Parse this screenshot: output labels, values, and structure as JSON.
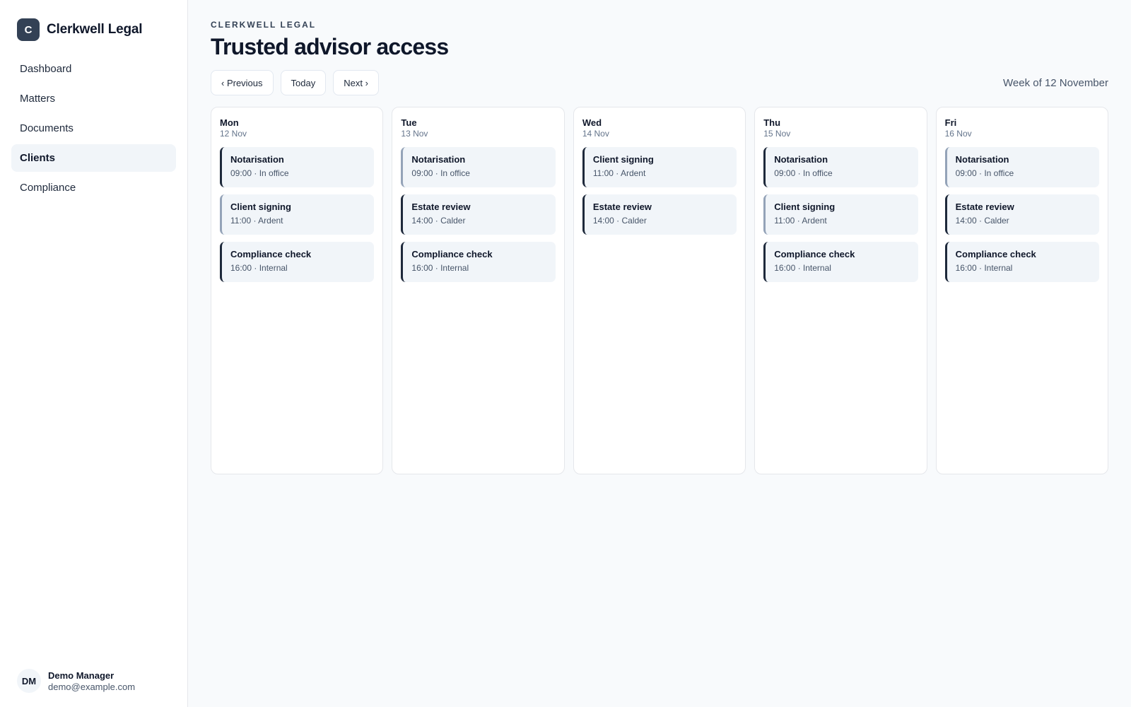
{
  "brand": {
    "logo_letter": "C",
    "name": "Clerkwell Legal"
  },
  "nav": [
    {
      "label": "Dashboard",
      "active": false
    },
    {
      "label": "Matters",
      "active": false
    },
    {
      "label": "Documents",
      "active": false
    },
    {
      "label": "Clients",
      "active": true
    },
    {
      "label": "Compliance",
      "active": false
    }
  ],
  "user": {
    "initials": "DM",
    "name": "Demo Manager",
    "email": "demo@example.com"
  },
  "header": {
    "eyebrow": "CLERKWELL LEGAL",
    "title": "Trusted advisor access"
  },
  "toolbar": {
    "previous_label": "‹ Previous",
    "today_label": "Today",
    "next_label": "Next ›",
    "week_label": "Week of 12 November"
  },
  "colors": {
    "accent": "#1e293b",
    "muted_accent": "#94a3b8",
    "event_bg": "#f1f5f9"
  },
  "days": [
    {
      "name": "Mon",
      "date": "12 Nov",
      "events": [
        {
          "title": "Notarisation",
          "meta": "09:00 · In office",
          "style": "accent"
        },
        {
          "title": "Client signing",
          "meta": "11:00 · Ardent",
          "style": "muted"
        },
        {
          "title": "Compliance check",
          "meta": "16:00 · Internal",
          "style": "accent"
        }
      ]
    },
    {
      "name": "Tue",
      "date": "13 Nov",
      "events": [
        {
          "title": "Notarisation",
          "meta": "09:00 · In office",
          "style": "muted"
        },
        {
          "title": "Estate review",
          "meta": "14:00 · Calder",
          "style": "accent"
        },
        {
          "title": "Compliance check",
          "meta": "16:00 · Internal",
          "style": "accent"
        }
      ]
    },
    {
      "name": "Wed",
      "date": "14 Nov",
      "events": [
        {
          "title": "Client signing",
          "meta": "11:00 · Ardent",
          "style": "accent"
        },
        {
          "title": "Estate review",
          "meta": "14:00 · Calder",
          "style": "accent"
        }
      ]
    },
    {
      "name": "Thu",
      "date": "15 Nov",
      "events": [
        {
          "title": "Notarisation",
          "meta": "09:00 · In office",
          "style": "accent"
        },
        {
          "title": "Client signing",
          "meta": "11:00 · Ardent",
          "style": "muted"
        },
        {
          "title": "Compliance check",
          "meta": "16:00 · Internal",
          "style": "accent"
        }
      ]
    },
    {
      "name": "Fri",
      "date": "16 Nov",
      "events": [
        {
          "title": "Notarisation",
          "meta": "09:00 · In office",
          "style": "muted"
        },
        {
          "title": "Estate review",
          "meta": "14:00 · Calder",
          "style": "accent"
        },
        {
          "title": "Compliance check",
          "meta": "16:00 · Internal",
          "style": "accent"
        }
      ]
    }
  ]
}
